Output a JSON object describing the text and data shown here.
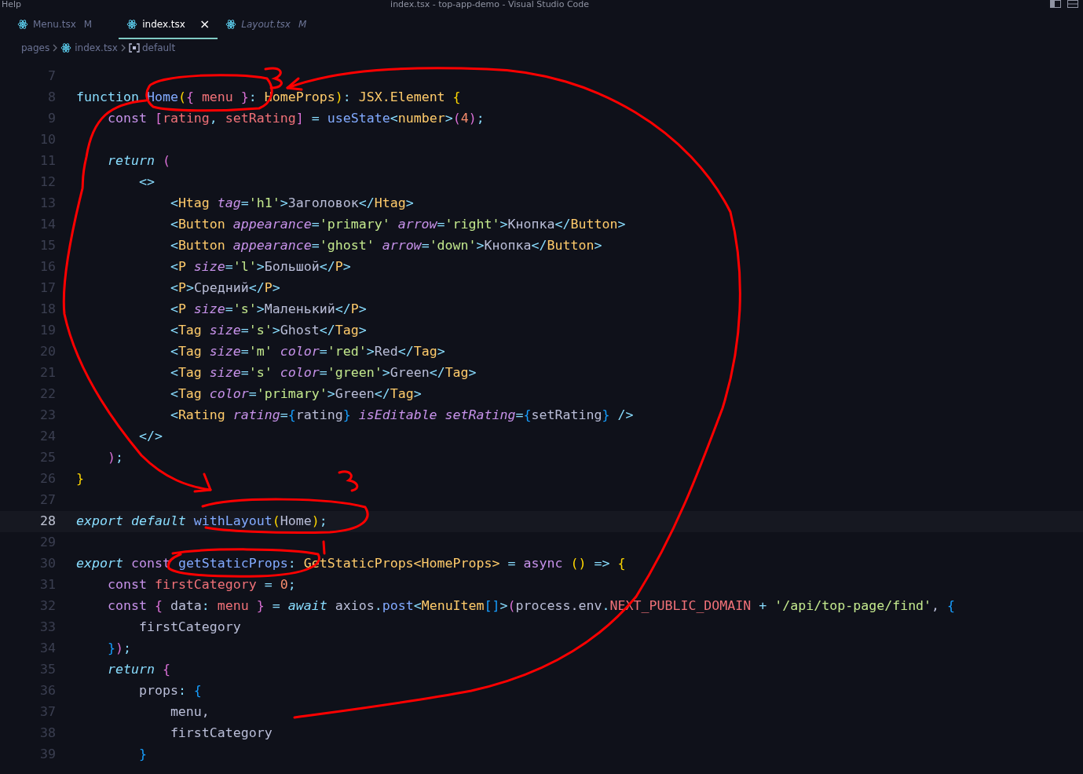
{
  "title_bar": {
    "menu": "Help",
    "title": "index.tsx - top-app-demo - Visual Studio Code"
  },
  "tabs": [
    {
      "label": "Menu.tsx",
      "badge": "M",
      "selected": false,
      "preview": false
    },
    {
      "label": "index.tsx",
      "close": "×",
      "selected": true,
      "preview": false
    },
    {
      "label": "Layout.tsx",
      "badge": "M",
      "selected": false,
      "preview": true
    }
  ],
  "breadcrumb": [
    {
      "label": "pages",
      "kind": "folder"
    },
    {
      "label": "index.tsx",
      "kind": "file"
    },
    {
      "label": "default",
      "kind": "symbol"
    }
  ],
  "editor": {
    "lines": [
      {
        "number": "7",
        "current": false
      },
      {
        "number": "8",
        "current": false,
        "tokens": [
          {
            "text": "function ",
            "kind": "kw"
          },
          {
            "text": "Home",
            "kind": "fn"
          },
          {
            "text": "(",
            "kind": "b1"
          },
          {
            "text": "{ ",
            "kind": "b2"
          },
          {
            "text": "menu",
            "kind": "var"
          },
          {
            "text": " }",
            "kind": "b2"
          },
          {
            "text": ": ",
            "kind": "p"
          },
          {
            "text": "HomeProps",
            "kind": "type"
          },
          {
            "text": ")",
            "kind": "b1"
          },
          {
            "text": ": ",
            "kind": "p"
          },
          {
            "text": "JSX.Element",
            "kind": "type"
          },
          {
            "text": " {",
            "kind": "b1"
          }
        ]
      },
      {
        "number": "9",
        "current": false,
        "tokens": [
          {
            "text": "    const ",
            "kind": "st"
          },
          {
            "text": "[",
            "kind": "b2"
          },
          {
            "text": "rating",
            "kind": "var"
          },
          {
            "text": ", ",
            "kind": "p"
          },
          {
            "text": "setRating",
            "kind": "var"
          },
          {
            "text": "]",
            "kind": "b2"
          },
          {
            "text": " = ",
            "kind": "p"
          },
          {
            "text": "useState",
            "kind": "fn"
          },
          {
            "text": "<",
            "kind": "p"
          },
          {
            "text": "number",
            "kind": "type"
          },
          {
            "text": ">",
            "kind": "p"
          },
          {
            "text": "(",
            "kind": "b2"
          },
          {
            "text": "4",
            "kind": "num"
          },
          {
            "text": ")",
            "kind": "b2"
          },
          {
            "text": ";",
            "kind": "p"
          }
        ]
      },
      {
        "number": "10",
        "current": false
      },
      {
        "number": "11",
        "current": false,
        "tokens": [
          {
            "text": "    return ",
            "kind": "kwi"
          },
          {
            "text": "(",
            "kind": "b2"
          }
        ]
      },
      {
        "number": "12",
        "current": false,
        "tokens": [
          {
            "text": "        <>",
            "kind": "p"
          }
        ]
      },
      {
        "number": "13",
        "current": false,
        "tokens": [
          {
            "text": "            <",
            "kind": "p"
          },
          {
            "text": "Htag",
            "kind": "tag"
          },
          {
            "text": " tag",
            "kind": "attr"
          },
          {
            "text": "=",
            "kind": "p"
          },
          {
            "text": "'h1'",
            "kind": "str"
          },
          {
            "text": ">",
            "kind": "p"
          },
          {
            "text": "Заголовок",
            "kind": "plain"
          },
          {
            "text": "</",
            "kind": "p"
          },
          {
            "text": "Htag",
            "kind": "tag"
          },
          {
            "text": ">",
            "kind": "p"
          }
        ]
      },
      {
        "number": "14",
        "current": false,
        "tokens": [
          {
            "text": "            <",
            "kind": "p"
          },
          {
            "text": "Button",
            "kind": "tag"
          },
          {
            "text": " appearance",
            "kind": "attr"
          },
          {
            "text": "=",
            "kind": "p"
          },
          {
            "text": "'primary'",
            "kind": "str"
          },
          {
            "text": " arrow",
            "kind": "attr"
          },
          {
            "text": "=",
            "kind": "p"
          },
          {
            "text": "'right'",
            "kind": "str"
          },
          {
            "text": ">",
            "kind": "p"
          },
          {
            "text": "Кнопка",
            "kind": "plain"
          },
          {
            "text": "</",
            "kind": "p"
          },
          {
            "text": "Button",
            "kind": "tag"
          },
          {
            "text": ">",
            "kind": "p"
          }
        ]
      },
      {
        "number": "15",
        "current": false,
        "tokens": [
          {
            "text": "            <",
            "kind": "p"
          },
          {
            "text": "Button",
            "kind": "tag"
          },
          {
            "text": " appearance",
            "kind": "attr"
          },
          {
            "text": "=",
            "kind": "p"
          },
          {
            "text": "'ghost'",
            "kind": "str"
          },
          {
            "text": " arrow",
            "kind": "attr"
          },
          {
            "text": "=",
            "kind": "p"
          },
          {
            "text": "'down'",
            "kind": "str"
          },
          {
            "text": ">",
            "kind": "p"
          },
          {
            "text": "Кнопка",
            "kind": "plain"
          },
          {
            "text": "</",
            "kind": "p"
          },
          {
            "text": "Button",
            "kind": "tag"
          },
          {
            "text": ">",
            "kind": "p"
          }
        ]
      },
      {
        "number": "16",
        "current": false,
        "tokens": [
          {
            "text": "            <",
            "kind": "p"
          },
          {
            "text": "P",
            "kind": "tag"
          },
          {
            "text": " size",
            "kind": "attr"
          },
          {
            "text": "=",
            "kind": "p"
          },
          {
            "text": "'l'",
            "kind": "str"
          },
          {
            "text": ">",
            "kind": "p"
          },
          {
            "text": "Большой",
            "kind": "plain"
          },
          {
            "text": "</",
            "kind": "p"
          },
          {
            "text": "P",
            "kind": "tag"
          },
          {
            "text": ">",
            "kind": "p"
          }
        ]
      },
      {
        "number": "17",
        "current": false,
        "tokens": [
          {
            "text": "            <",
            "kind": "p"
          },
          {
            "text": "P",
            "kind": "tag"
          },
          {
            "text": ">",
            "kind": "p"
          },
          {
            "text": "Средний",
            "kind": "plain"
          },
          {
            "text": "</",
            "kind": "p"
          },
          {
            "text": "P",
            "kind": "tag"
          },
          {
            "text": ">",
            "kind": "p"
          }
        ]
      },
      {
        "number": "18",
        "current": false,
        "tokens": [
          {
            "text": "            <",
            "kind": "p"
          },
          {
            "text": "P",
            "kind": "tag"
          },
          {
            "text": " size",
            "kind": "attr"
          },
          {
            "text": "=",
            "kind": "p"
          },
          {
            "text": "'s'",
            "kind": "str"
          },
          {
            "text": ">",
            "kind": "p"
          },
          {
            "text": "Маленький",
            "kind": "plain"
          },
          {
            "text": "</",
            "kind": "p"
          },
          {
            "text": "P",
            "kind": "tag"
          },
          {
            "text": ">",
            "kind": "p"
          }
        ]
      },
      {
        "number": "19",
        "current": false,
        "tokens": [
          {
            "text": "            <",
            "kind": "p"
          },
          {
            "text": "Tag",
            "kind": "tag"
          },
          {
            "text": " size",
            "kind": "attr"
          },
          {
            "text": "=",
            "kind": "p"
          },
          {
            "text": "'s'",
            "kind": "str"
          },
          {
            "text": ">",
            "kind": "p"
          },
          {
            "text": "Ghost",
            "kind": "plain"
          },
          {
            "text": "</",
            "kind": "p"
          },
          {
            "text": "Tag",
            "kind": "tag"
          },
          {
            "text": ">",
            "kind": "p"
          }
        ]
      },
      {
        "number": "20",
        "current": false,
        "tokens": [
          {
            "text": "            <",
            "kind": "p"
          },
          {
            "text": "Tag",
            "kind": "tag"
          },
          {
            "text": " size",
            "kind": "attr"
          },
          {
            "text": "=",
            "kind": "p"
          },
          {
            "text": "'m'",
            "kind": "str"
          },
          {
            "text": " color",
            "kind": "attr"
          },
          {
            "text": "=",
            "kind": "p"
          },
          {
            "text": "'red'",
            "kind": "str"
          },
          {
            "text": ">",
            "kind": "p"
          },
          {
            "text": "Red",
            "kind": "plain"
          },
          {
            "text": "</",
            "kind": "p"
          },
          {
            "text": "Tag",
            "kind": "tag"
          },
          {
            "text": ">",
            "kind": "p"
          }
        ]
      },
      {
        "number": "21",
        "current": false,
        "tokens": [
          {
            "text": "            <",
            "kind": "p"
          },
          {
            "text": "Tag",
            "kind": "tag"
          },
          {
            "text": " size",
            "kind": "attr"
          },
          {
            "text": "=",
            "kind": "p"
          },
          {
            "text": "'s'",
            "kind": "str"
          },
          {
            "text": " color",
            "kind": "attr"
          },
          {
            "text": "=",
            "kind": "p"
          },
          {
            "text": "'green'",
            "kind": "str"
          },
          {
            "text": ">",
            "kind": "p"
          },
          {
            "text": "Green",
            "kind": "plain"
          },
          {
            "text": "</",
            "kind": "p"
          },
          {
            "text": "Tag",
            "kind": "tag"
          },
          {
            "text": ">",
            "kind": "p"
          }
        ]
      },
      {
        "number": "22",
        "current": false,
        "tokens": [
          {
            "text": "            <",
            "kind": "p"
          },
          {
            "text": "Tag",
            "kind": "tag"
          },
          {
            "text": " color",
            "kind": "attr"
          },
          {
            "text": "=",
            "kind": "p"
          },
          {
            "text": "'primary'",
            "kind": "str"
          },
          {
            "text": ">",
            "kind": "p"
          },
          {
            "text": "Green",
            "kind": "plain"
          },
          {
            "text": "</",
            "kind": "p"
          },
          {
            "text": "Tag",
            "kind": "tag"
          },
          {
            "text": ">",
            "kind": "p"
          }
        ]
      },
      {
        "number": "23",
        "current": false,
        "tokens": [
          {
            "text": "            <",
            "kind": "p"
          },
          {
            "text": "Rating",
            "kind": "tag"
          },
          {
            "text": " rating",
            "kind": "attr"
          },
          {
            "text": "=",
            "kind": "p"
          },
          {
            "text": "{",
            "kind": "b3"
          },
          {
            "text": "rating",
            "kind": "plain"
          },
          {
            "text": "}",
            "kind": "b3"
          },
          {
            "text": " isEditable",
            "kind": "attr"
          },
          {
            "text": " setRating",
            "kind": "attr"
          },
          {
            "text": "=",
            "kind": "p"
          },
          {
            "text": "{",
            "kind": "b3"
          },
          {
            "text": "setRating",
            "kind": "plain"
          },
          {
            "text": "}",
            "kind": "b3"
          },
          {
            "text": " />",
            "kind": "p"
          }
        ]
      },
      {
        "number": "24",
        "current": false,
        "tokens": [
          {
            "text": "        </>",
            "kind": "p"
          }
        ]
      },
      {
        "number": "25",
        "current": false,
        "tokens": [
          {
            "text": "    )",
            "kind": "b2"
          },
          {
            "text": ";",
            "kind": "p"
          }
        ]
      },
      {
        "number": "26",
        "current": false,
        "tokens": [
          {
            "text": "}",
            "kind": "b1"
          }
        ]
      },
      {
        "number": "27",
        "current": false
      },
      {
        "number": "28",
        "current": true,
        "tokens": [
          {
            "text": "export default ",
            "kind": "kwi"
          },
          {
            "text": "withLayout",
            "kind": "fn"
          },
          {
            "text": "(",
            "kind": "b1"
          },
          {
            "text": "Home",
            "kind": "plain"
          },
          {
            "text": ")",
            "kind": "b1"
          },
          {
            "text": ";",
            "kind": "p"
          }
        ]
      },
      {
        "number": "29",
        "current": false
      },
      {
        "number": "30",
        "current": false,
        "tokens": [
          {
            "text": "export ",
            "kind": "kwi"
          },
          {
            "text": "const ",
            "kind": "st"
          },
          {
            "text": "getStaticProps",
            "kind": "fn"
          },
          {
            "text": ": ",
            "kind": "p"
          },
          {
            "text": "GetStaticProps<HomeProps>",
            "kind": "type"
          },
          {
            "text": " = ",
            "kind": "p"
          },
          {
            "text": "async ",
            "kind": "st"
          },
          {
            "text": "()",
            "kind": "b1"
          },
          {
            "text": " => ",
            "kind": "p"
          },
          {
            "text": "{",
            "kind": "b1"
          }
        ]
      },
      {
        "number": "31",
        "current": false,
        "tokens": [
          {
            "text": "    const ",
            "kind": "st"
          },
          {
            "text": "firstCategory",
            "kind": "var"
          },
          {
            "text": " = ",
            "kind": "p"
          },
          {
            "text": "0",
            "kind": "num"
          },
          {
            "text": ";",
            "kind": "p"
          }
        ]
      },
      {
        "number": "32",
        "current": false,
        "tokens": [
          {
            "text": "    const ",
            "kind": "st"
          },
          {
            "text": "{ ",
            "kind": "b2"
          },
          {
            "text": "data",
            "kind": "plain"
          },
          {
            "text": ": ",
            "kind": "p"
          },
          {
            "text": "menu",
            "kind": "var"
          },
          {
            "text": " }",
            "kind": "b2"
          },
          {
            "text": " = ",
            "kind": "p"
          },
          {
            "text": "await ",
            "kind": "kwi"
          },
          {
            "text": "axios",
            "kind": "plain"
          },
          {
            "text": ".",
            "kind": "p"
          },
          {
            "text": "post",
            "kind": "fn"
          },
          {
            "text": "<",
            "kind": "p"
          },
          {
            "text": "MenuItem",
            "kind": "type"
          },
          {
            "text": "[]",
            "kind": "b3"
          },
          {
            "text": ">",
            "kind": "p"
          },
          {
            "text": "(",
            "kind": "b2"
          },
          {
            "text": "process.env",
            "kind": "plain"
          },
          {
            "text": ".",
            "kind": "p"
          },
          {
            "text": "NEXT_PUBLIC_DOMAIN",
            "kind": "var"
          },
          {
            "text": " + ",
            "kind": "p"
          },
          {
            "text": "'/api/top-page/find'",
            "kind": "str"
          },
          {
            "text": ", ",
            "kind": "plain"
          },
          {
            "text": "{",
            "kind": "b3"
          }
        ]
      },
      {
        "number": "33",
        "current": false,
        "tokens": [
          {
            "text": "        firstCategory",
            "kind": "plain"
          }
        ]
      },
      {
        "number": "34",
        "current": false,
        "tokens": [
          {
            "text": "    }",
            "kind": "b3"
          },
          {
            "text": ")",
            "kind": "b2"
          },
          {
            "text": ";",
            "kind": "p"
          }
        ]
      },
      {
        "number": "35",
        "current": false,
        "tokens": [
          {
            "text": "    return ",
            "kind": "kwi"
          },
          {
            "text": "{",
            "kind": "b2"
          }
        ]
      },
      {
        "number": "36",
        "current": false,
        "tokens": [
          {
            "text": "        props",
            "kind": "plain"
          },
          {
            "text": ": ",
            "kind": "p"
          },
          {
            "text": "{",
            "kind": "b3"
          }
        ]
      },
      {
        "number": "37",
        "current": false,
        "tokens": [
          {
            "text": "            menu,",
            "kind": "plain"
          }
        ]
      },
      {
        "number": "38",
        "current": false,
        "tokens": [
          {
            "text": "            firstCategory",
            "kind": "plain"
          }
        ]
      },
      {
        "number": "39",
        "current": false,
        "tokens": [
          {
            "text": "        }",
            "kind": "b3"
          }
        ]
      }
    ]
  }
}
